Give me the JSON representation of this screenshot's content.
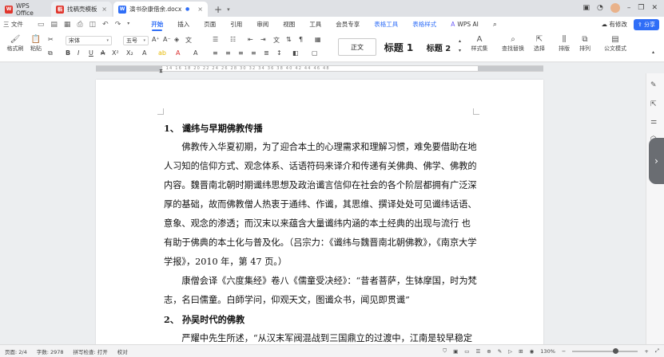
{
  "titlebar": {
    "tabs": [
      {
        "label": "WPS Office",
        "icon": "wps-logo-icon",
        "color": "#e0362d"
      },
      {
        "label": "找稿壳模板",
        "icon": "template-icon",
        "color": "#e0362d"
      },
      {
        "label": "演书杂康借余.docx",
        "icon": "word-doc-icon",
        "color": "#2f6ef7"
      }
    ],
    "new_tab": "+"
  },
  "menubar": {
    "file": "三 文件",
    "menus": [
      "开始",
      "插入",
      "页面",
      "引用",
      "审阅",
      "视图",
      "工具",
      "会员专享",
      "表格工具",
      "表格样式"
    ],
    "active": "开始",
    "ai": "WPS AI",
    "modified": "有修改",
    "share": "分享"
  },
  "ribbon": {
    "format_painter": "格式刷",
    "paste": "粘贴",
    "font_name": "宋体",
    "font_size": "五号",
    "styles": [
      "正文",
      "标题 1",
      "标题 2"
    ],
    "style_set": "样式集",
    "find_replace": "查找替换",
    "select": "选择",
    "sort": "排版",
    "arrange": "排列",
    "formula": "公文模式"
  },
  "ruler": "8 6 4 2 1 2 4 6 8 10 12 14 16 18 20 22 24 26 28 30 32 34 36 38 40 42 44 46 48",
  "document": {
    "heading1": "1、  谶纬与早期佛教传播",
    "para1": "佛教传入华夏初期，为了迎合本土的心理需求和理解习惯，难免要借助在地人习知的信仰方式、观念体系、话语符码来译介和传递有关佛典、佛学、佛教的内容。魏晋南北朝时期谶纬思想及政治谶言信仰在社会的各个阶层都拥有广泛深厚的基础，故而佛教僧人热衷于通纬、作谶，其思维、撰译处处可见谶纬话语、意象、观念的渗透；而汉末以来蕴含大量谶纬内涵的本土经典的出现与流行  也有助于佛典的本土化与普及化。（吕宗力：《谶纬与魏晋南北朝佛教》，《南京大学学报》，2010 年，第 47 页。）",
    "para2": "康僧会译《六度集经》卷八《儒童受决经》：“昔者菩萨，生钵摩国，时为梵志，名曰儒童。白師学问，仰观天文，图谶众书，闻见即贯谶”",
    "heading2": "2、  孙吴时代的佛教",
    "para3": "严耀中先生所述，“从汉末军阀混战到三国鼎立的过渡中，江南是较早稳定下来的地区之一。…因此，相对安定的江南不仅成为北方流民的移入地区，而且"
  },
  "status": {
    "page": "页面: 2/4",
    "words": "字数: 2978",
    "spell": "拼写检查: 打开",
    "proof": "校对",
    "zoom": "130%",
    "zoom_level": 0.62
  },
  "colors": {
    "accent": "#2f6ef7",
    "wps_red": "#e0362d"
  }
}
